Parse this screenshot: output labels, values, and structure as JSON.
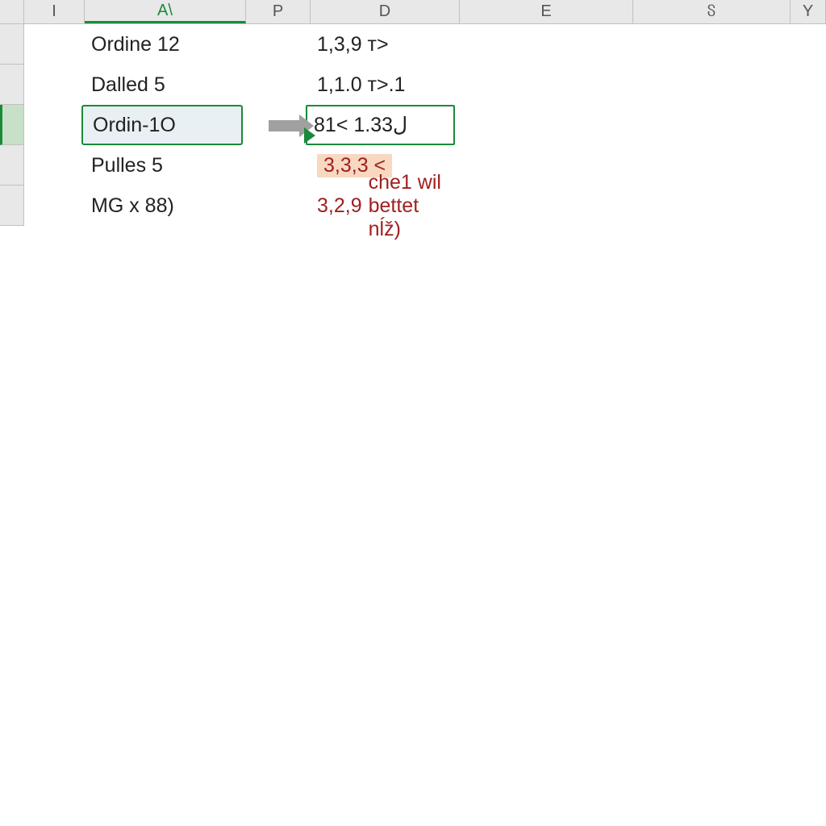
{
  "columns": {
    "I": "I",
    "A": "A\\",
    "P": "P",
    "D": "D",
    "E": "E",
    "S": "ჽ",
    "Y": "Y"
  },
  "rows": [
    {
      "A": "Ordine 12",
      "D": "1,3,9 т>"
    },
    {
      "A": "Dalled 5",
      "D": "1,1.0 т>.1"
    },
    {
      "A": "Ordin-1O",
      "D": "ل1.33 >81",
      "A_selected": true,
      "D_selected": true
    },
    {
      "A": "Pulles 5",
      "D": "3,3,3 <",
      "D_red": true,
      "D_peach": true
    },
    {
      "A": "MG x 88)",
      "D": "3,2,9",
      "D_red": true,
      "E": "che1 wil bettet nĺž)",
      "E_red": true
    }
  ]
}
